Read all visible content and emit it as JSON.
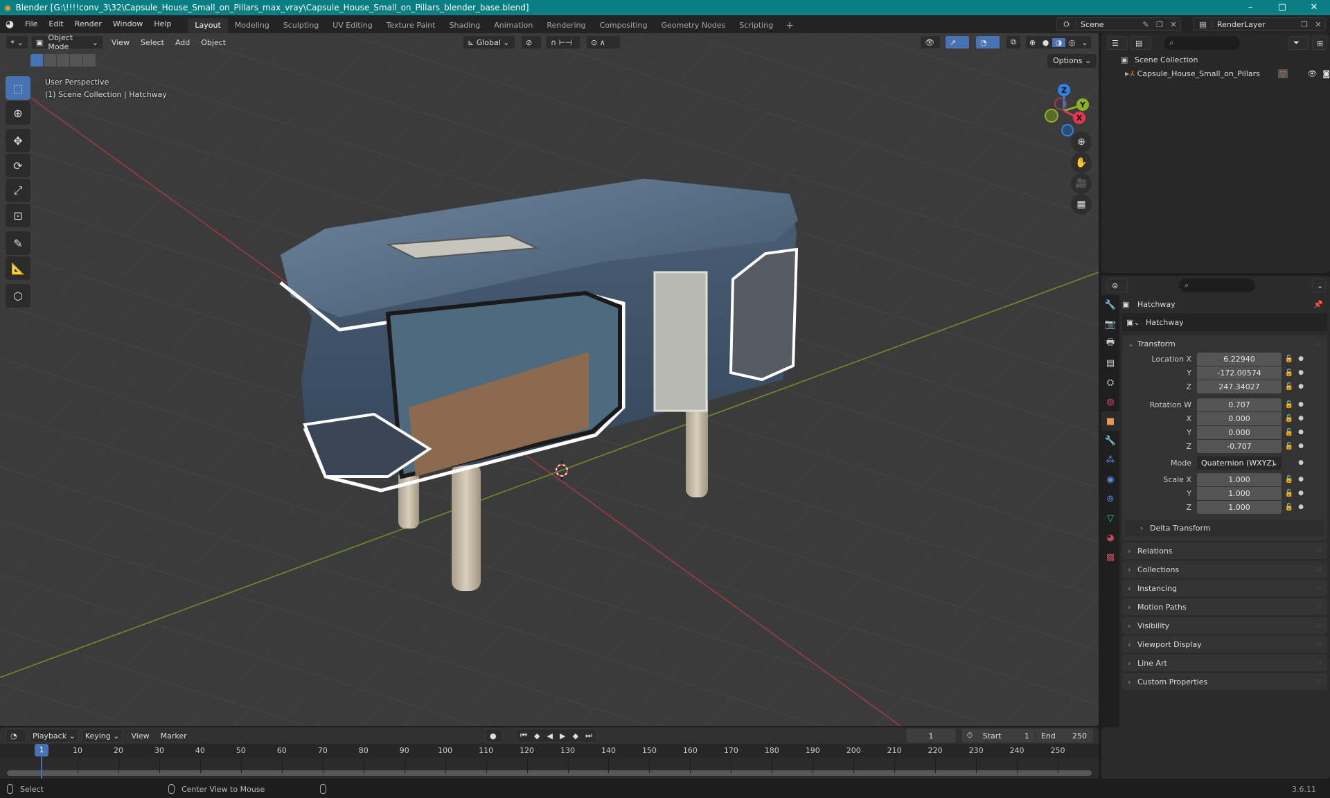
{
  "window": {
    "title": "Blender [G:\\!!!!conv_3\\32\\Capsule_House_Small_on_Pillars_max_vray\\Capsule_House_Small_on_Pillars_blender_base.blend]",
    "app_icon": "blender-logo-icon",
    "controls": [
      "minimize",
      "maximize",
      "close"
    ],
    "controls_glyphs": [
      "–",
      "▢",
      "✕"
    ]
  },
  "menubar": {
    "menus": [
      "File",
      "Edit",
      "Render",
      "Window",
      "Help"
    ],
    "workspaces": [
      "Layout",
      "Modeling",
      "Sculpting",
      "UV Editing",
      "Texture Paint",
      "Shading",
      "Animation",
      "Rendering",
      "Compositing",
      "Geometry Nodes",
      "Scripting"
    ],
    "active_workspace": "Layout",
    "add_workspace": "+",
    "scene": "Scene",
    "view_layer": "RenderLayer"
  },
  "viewport": {
    "mode": "Object Mode",
    "menus": [
      "View",
      "Select",
      "Add",
      "Object"
    ],
    "transform_orientation": "Global",
    "options_label": "Options",
    "perspective_label": "User Perspective",
    "collection_label": "(1) Scene Collection | Hatchway",
    "gizmo_axes": {
      "x": "X",
      "y": "Y",
      "z": "Z"
    },
    "axis_colors": {
      "x": "#e5364f",
      "y": "#88b325",
      "z": "#2f82e0"
    },
    "tools": [
      "select-box",
      "cursor",
      "move",
      "rotate",
      "scale",
      "transform",
      "annotate",
      "measure",
      "add-cube"
    ],
    "nav_buttons": [
      "zoom",
      "pan",
      "camera",
      "perspective-toggle"
    ]
  },
  "outliner": {
    "root": "Scene Collection",
    "items": [
      {
        "name": "Capsule_House_Small_on_Pillars",
        "type": "empty"
      }
    ]
  },
  "properties": {
    "object_name": "Hatchway",
    "datablock_name": "Hatchway",
    "transform_label": "Transform",
    "location": {
      "label": "Location X",
      "x": "6.22940",
      "y": "-172.00574",
      "z": "247.34027"
    },
    "rotation": {
      "label": "Rotation W",
      "w": "0.707",
      "x": "0.000",
      "y": "0.000",
      "z": "-0.707"
    },
    "mode_label": "Mode",
    "rotation_mode": "Quaternion (WXYZ)",
    "scale": {
      "label": "Scale X",
      "x": "1.000",
      "y": "1.000",
      "z": "1.000"
    },
    "axis_labels": {
      "x": "X",
      "y": "Y",
      "z": "Z"
    },
    "subpanel": "Delta Transform",
    "panels": [
      "Relations",
      "Collections",
      "Instancing",
      "Motion Paths",
      "Visibility",
      "Viewport Display",
      "Line Art",
      "Custom Properties"
    ]
  },
  "timeline": {
    "menus": [
      "Playback",
      "Keying",
      "View",
      "Marker"
    ],
    "current_frame": "1",
    "start_label": "Start",
    "start": "1",
    "end_label": "End",
    "end": "250",
    "ticks": [
      "10",
      "20",
      "30",
      "40",
      "50",
      "60",
      "70",
      "80",
      "90",
      "100",
      "110",
      "120",
      "130",
      "140",
      "150",
      "160",
      "170",
      "180",
      "190",
      "200",
      "210",
      "220",
      "230",
      "240",
      "250"
    ],
    "playhead_frame": "1"
  },
  "statusbar": {
    "left_click": "Select",
    "middle_click": "Center View to Mouse",
    "version": "3.6.11"
  }
}
